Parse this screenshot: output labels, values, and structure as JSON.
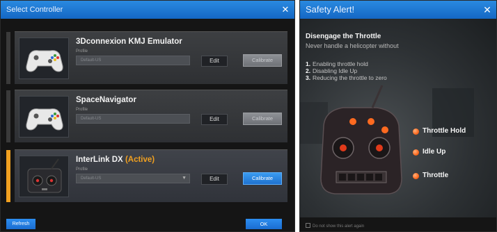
{
  "left_dialog": {
    "title": "Select Controller",
    "close_glyph": "✕",
    "controllers": [
      {
        "name": "3Dconnexion KMJ Emulator",
        "active_label": "",
        "profile_label": "Profile",
        "profile_value": "Default-US",
        "edit_label": "Edit",
        "calibrate_label": "Calibrate",
        "active": false,
        "image": "gamepad-icon"
      },
      {
        "name": "SpaceNavigator",
        "active_label": "",
        "profile_label": "Profile",
        "profile_value": "Default-US",
        "edit_label": "Edit",
        "calibrate_label": "Calibrate",
        "active": false,
        "image": "gamepad-icon"
      },
      {
        "name": "InterLink DX",
        "active_label": "(Active)",
        "profile_label": "Profile",
        "profile_value": "Default-US",
        "edit_label": "Edit",
        "calibrate_label": "Calibrate",
        "active": true,
        "image": "rc-transmitter-icon"
      }
    ],
    "refresh_label": "Refresh",
    "ok_label": "OK"
  },
  "right_dialog": {
    "title": "Safety Alert!",
    "close_glyph": "✕",
    "heading": "Disengage the Throttle",
    "subheading": "Never handle a helicopter without",
    "steps": [
      {
        "num": "1.",
        "text": "Enabling throttle hold"
      },
      {
        "num": "2.",
        "text": "Disabling Idle Up"
      },
      {
        "num": "3.",
        "text": "Reducing the throttle to zero"
      }
    ],
    "legend": [
      {
        "label": "Throttle Hold"
      },
      {
        "label": "Idle Up"
      },
      {
        "label": "Throttle"
      }
    ],
    "dont_show_label": "Do not show this alert again"
  },
  "colors": {
    "title_blue": "#1a6fcf",
    "active_accent": "#f0a020",
    "legend_dot": "#ff6a20"
  }
}
